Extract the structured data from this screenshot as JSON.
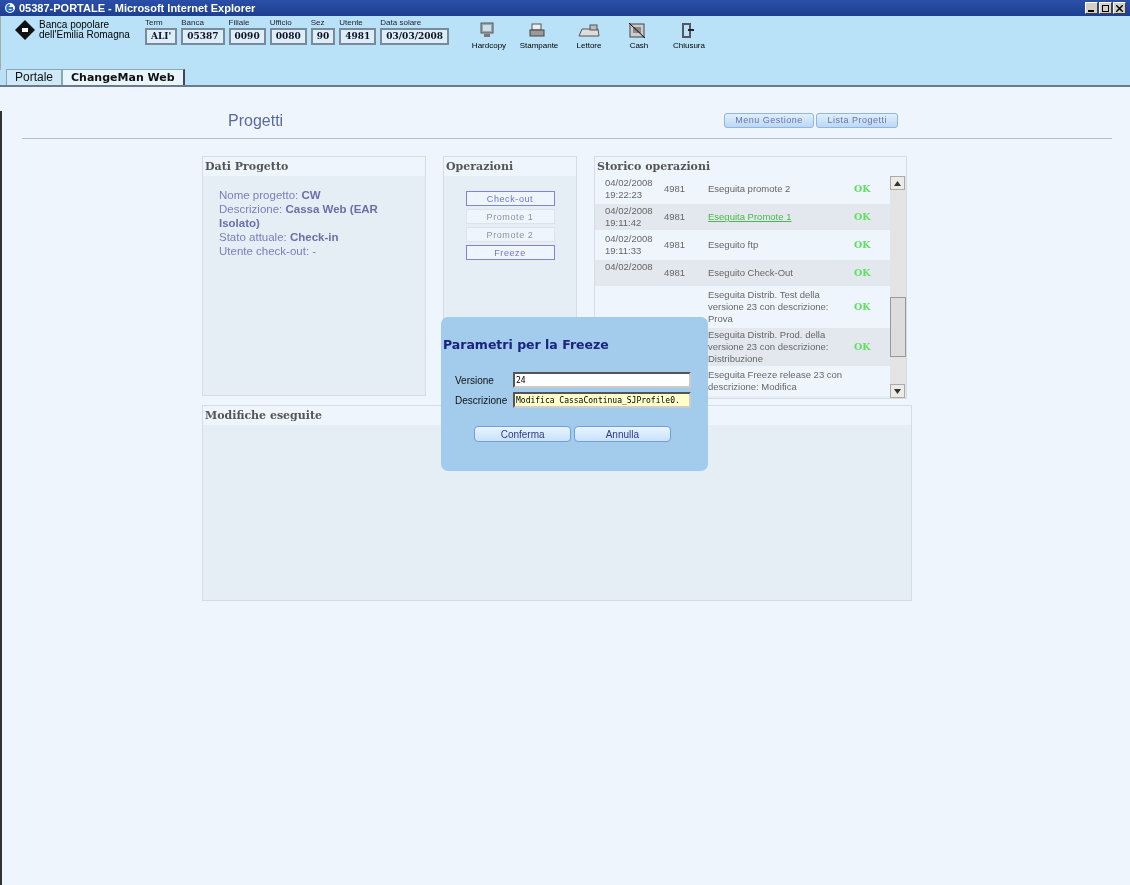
{
  "window": {
    "title": "05387-PORTALE - Microsoft Internet Explorer"
  },
  "header": {
    "logo_line_1": "Banca popolare",
    "logo_line_2": "dell'Emilia Romagna",
    "fields": [
      {
        "label": "Term",
        "value": "ALI'"
      },
      {
        "label": "Banca",
        "value": "05387"
      },
      {
        "label": "Filiale",
        "value": "0090"
      },
      {
        "label": "Ufficio",
        "value": "0080"
      },
      {
        "label": "Sez",
        "value": "90"
      },
      {
        "label": "Utente",
        "value": "4981"
      },
      {
        "label": "Data solare",
        "value": "03/03/2008"
      }
    ],
    "tools": [
      {
        "kind": "monitor",
        "label": "Hardcopy"
      },
      {
        "kind": "printer",
        "label": "Stampante"
      },
      {
        "kind": "reader",
        "label": "Lettore"
      },
      {
        "kind": "cash",
        "label": "Cash"
      },
      {
        "kind": "exit",
        "label": "Chiusura"
      }
    ]
  },
  "tabs": [
    {
      "label": "Portale",
      "selected": false
    },
    {
      "label": "ChangeMan Web",
      "selected": true
    }
  ],
  "page": {
    "title": "Progetti",
    "buttons": [
      "Menu Gestione",
      "Lista Progetti"
    ]
  },
  "dati_progetto": {
    "title": "Dati Progetto",
    "lines": [
      "Nome progetto: **CW**",
      "Descrizione: **Cassa Web (EAR Isolato)**",
      "Stato attuale: **Check-in**",
      "Utente check-out: -"
    ]
  },
  "operazioni": {
    "title": "Operazioni",
    "buttons": [
      {
        "label": "Check-out",
        "disabled": false
      },
      {
        "label": "Promote 1",
        "disabled": true
      },
      {
        "label": "Promote 2",
        "disabled": true
      },
      {
        "label": "Freeze",
        "disabled": false
      }
    ]
  },
  "storico": {
    "title": "Storico operazioni",
    "rows": [
      {
        "date": "04/02/2008",
        "time": "19:22:23",
        "user": "4981",
        "kind": "text",
        "description": "Eseguita promote 2",
        "status": "OK"
      },
      {
        "date": "04/02/2008",
        "time": "19:11:42",
        "user": "4981",
        "kind": "link",
        "description": "Eseguita Promote 1",
        "status": "OK"
      },
      {
        "date": "04/02/2008",
        "time": "19:11:33",
        "user": "4981",
        "kind": "text",
        "description": "Eseguito ftp",
        "status": "OK"
      },
      {
        "date": "04/02/2008",
        "user": "4981",
        "kind": "text",
        "description": "Eseguito Check-Out",
        "status": "OK"
      },
      {
        "kind": "text",
        "description": "Eseguita Distrib. Test della versione 23 con descrizione: Prova",
        "status": "OK"
      },
      {
        "kind": "text",
        "description": "Eseguita Distrib. Prod. della versione 23 con descrizione: Distribuzione",
        "status": "OK"
      },
      {
        "kind": "text",
        "description": "Eseguita Freeze release 23 con descrizione: Modifica"
      }
    ]
  },
  "modifiche": {
    "title": "Modifiche eseguite"
  },
  "dialog": {
    "title": "Parametri per la Freeze",
    "fields": [
      {
        "label": "Versione",
        "value": "24",
        "highlighted": false
      },
      {
        "label": "Descrizione",
        "value": "Modifica CassaContinua_SJProfile0.",
        "highlighted": true
      }
    ],
    "buttons": [
      "Conferma",
      "Annulla"
    ]
  }
}
